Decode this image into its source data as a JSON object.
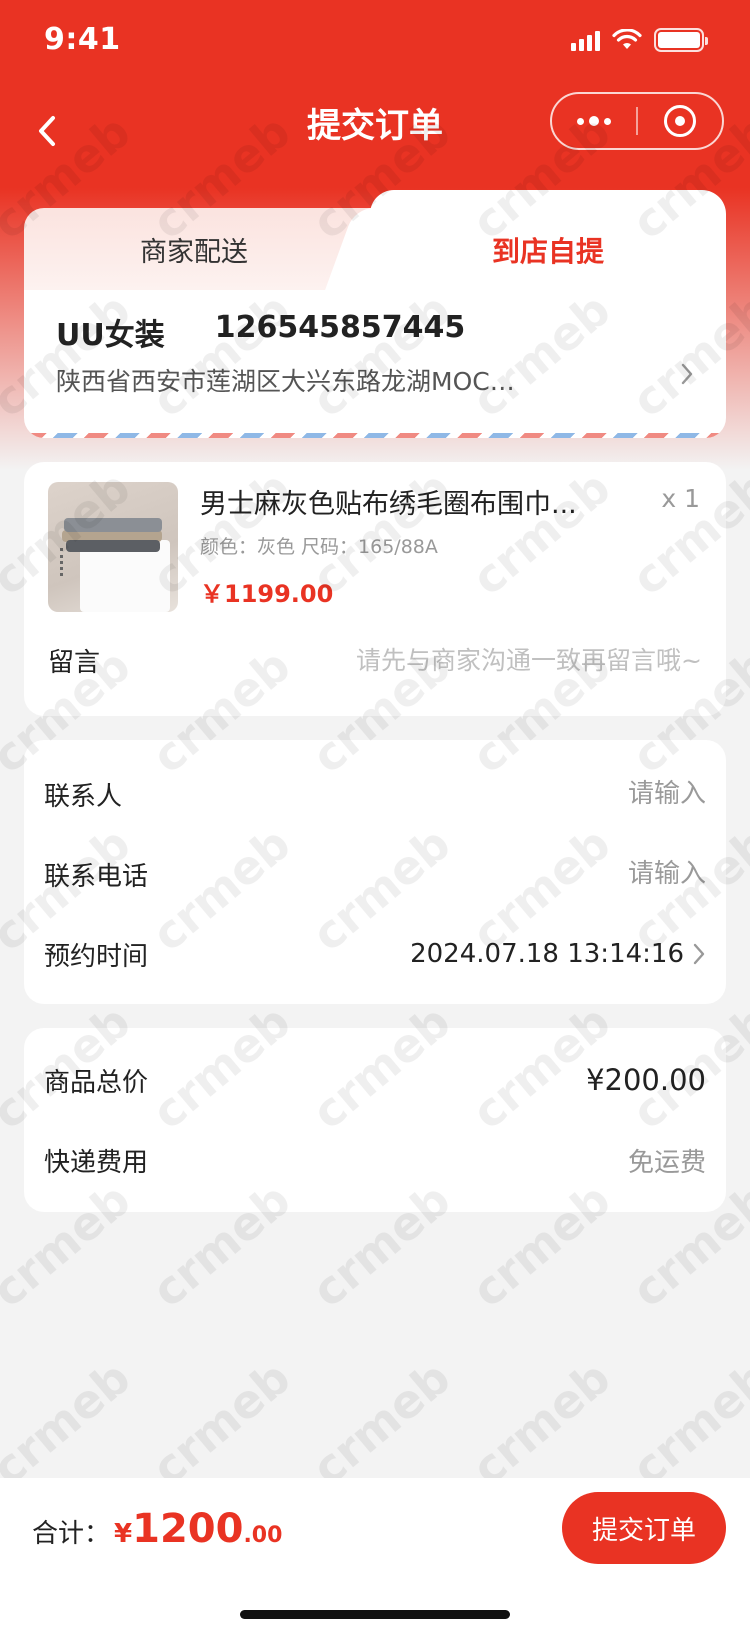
{
  "status_bar": {
    "time": "9:41"
  },
  "nav": {
    "title": "提交订单"
  },
  "delivery_tabs": [
    {
      "label": "商家配送",
      "active": false
    },
    {
      "label": "到店自提",
      "active": true
    }
  ],
  "address": {
    "name": "UU女装",
    "phone": "126545857445",
    "detail": "陕西省西安市莲湖区大兴东路龙湖MOC…"
  },
  "product": {
    "name": "男士麻灰色贴布绣毛圈布围巾...",
    "quantity": "x 1",
    "spec": "颜色：灰色   尺码：165/88A",
    "price": "￥1199.00",
    "message_label": "留言",
    "message_placeholder": "请先与商家沟通一致再留言哦~"
  },
  "contact": {
    "contact_label": "联系人",
    "contact_placeholder": "请输入",
    "phone_label": "联系电话",
    "phone_placeholder": "请输入",
    "time_label": "预约时间",
    "time_value": "2024.07.18 13:14:16"
  },
  "prices": {
    "goods_label": "商品总价",
    "goods_value": "¥200.00",
    "shipping_label": "快递费用",
    "shipping_value": "免运费"
  },
  "footer": {
    "total_label": "合计：",
    "total_currency": "¥",
    "total_integer": "1200",
    "total_decimal": ".00",
    "submit_label": "提交订单"
  },
  "watermark": {
    "text": "crmeb"
  },
  "colors": {
    "accent": "#e93323",
    "background": "#f3f3f3"
  }
}
